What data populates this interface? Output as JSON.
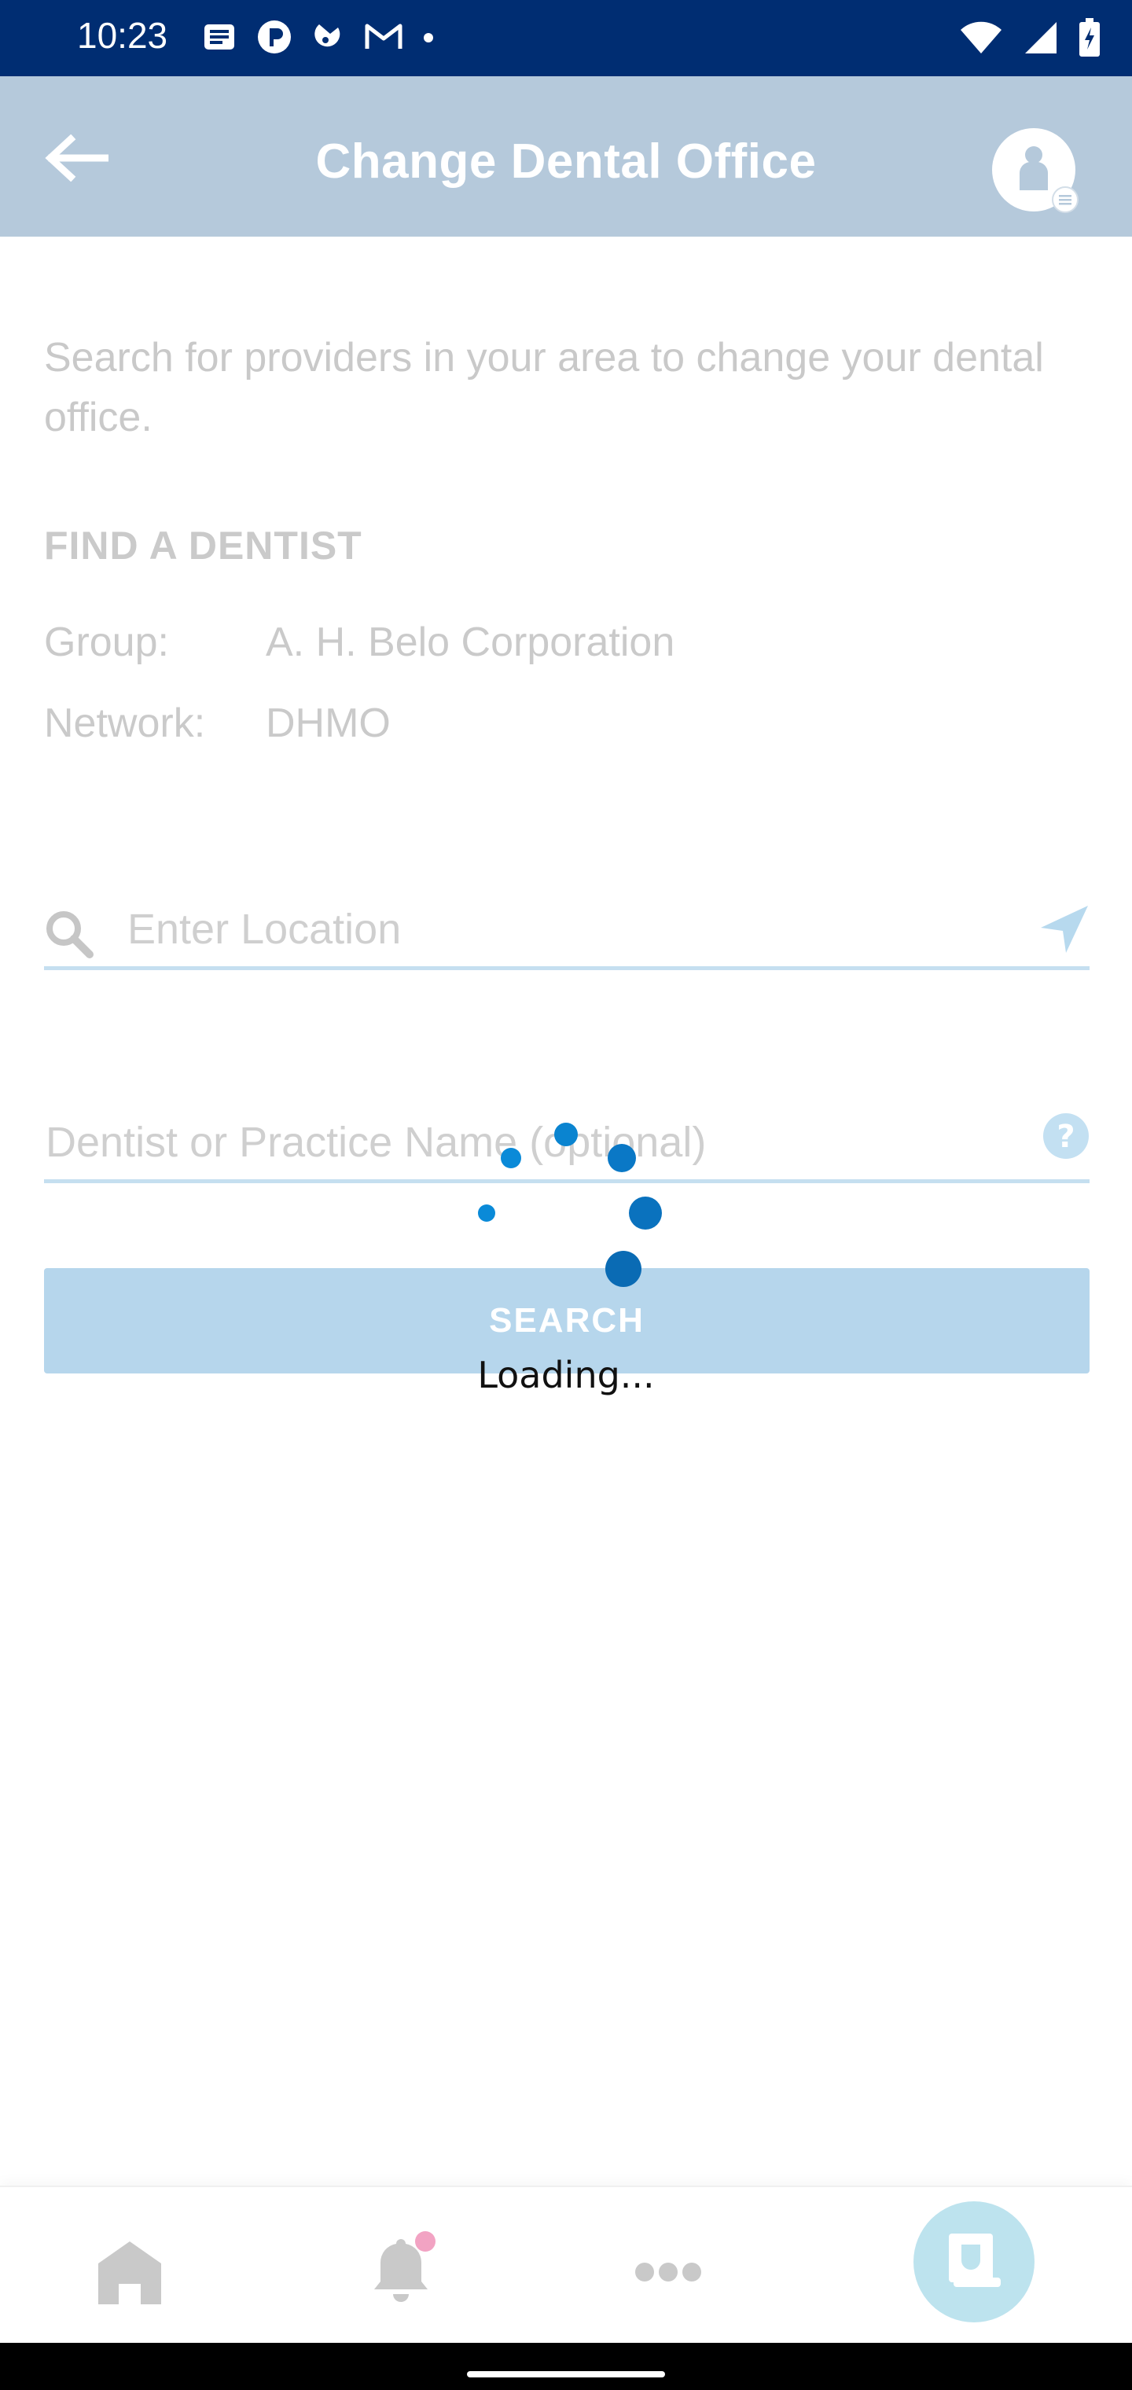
{
  "status_bar": {
    "time": "10:23",
    "left_icons": [
      "news-icon",
      "p-circle-icon",
      "tag-icon",
      "gmail-icon",
      "dot-icon"
    ],
    "right_icons": [
      "wifi-icon",
      "signal-icon",
      "battery-icon"
    ]
  },
  "header": {
    "title": "Change Dental Office",
    "back_icon": "arrow-left-icon",
    "profile_icon": "user-avatar-icon"
  },
  "intro": "Search for providers in your area to change your dental office.",
  "find_dentist": {
    "heading": "FIND A DENTIST",
    "group_label": "Group:",
    "group_value": "A. H. Belo Corporation",
    "network_label": "Network:",
    "network_value": "DHMO"
  },
  "location_field": {
    "placeholder": "Enter Location",
    "value": ""
  },
  "dentist_field": {
    "placeholder": "Dentist or Practice Name (optional)",
    "value": ""
  },
  "search_button": {
    "label": "SEARCH"
  },
  "loading": {
    "text": "Loading..."
  },
  "bottom_nav": {
    "items": [
      "home-icon",
      "bell-icon",
      "more-icon",
      "dental-card-icon"
    ],
    "active": "dental-card-icon"
  },
  "colors": {
    "status_bar": "#002d72",
    "header": "#b5c9db",
    "accent": "#0a84d0",
    "spinner_dark": "#0a6fb8",
    "notification_dot": "#f2a3c3"
  }
}
